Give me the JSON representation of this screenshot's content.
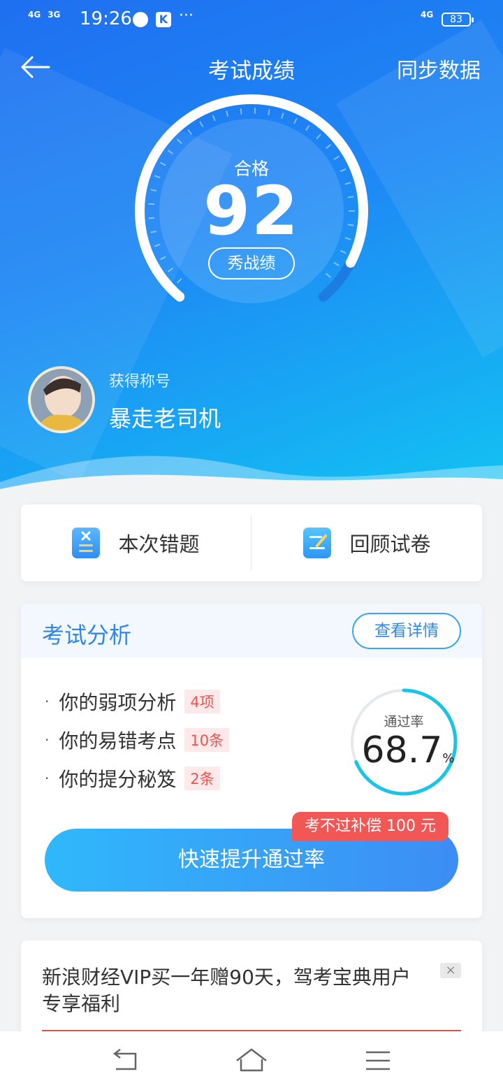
{
  "status_bar": {
    "network_1": "4G",
    "network_2": "3G",
    "time": "19:26",
    "more": "···",
    "signal_label": "4G",
    "battery": "83"
  },
  "header": {
    "title": "考试成绩",
    "sync_label": "同步数据"
  },
  "score": {
    "status_label": "合格",
    "value": "92",
    "share_label": "秀战绩",
    "progress": 0.92
  },
  "profile": {
    "caption": "获得称号",
    "title": "暴走老司机"
  },
  "actions": {
    "wrong_questions": "本次错题",
    "review_paper": "回顾试卷"
  },
  "analysis": {
    "title": "考试分析",
    "detail_button": "查看详情",
    "items": [
      {
        "text": "你的弱项分析",
        "tag": "4项"
      },
      {
        "text": "你的易错考点",
        "tag": "10条"
      },
      {
        "text": "你的提分秘笈",
        "tag": "2条"
      }
    ],
    "pass_rate_label": "通过率",
    "pass_rate_value": "68.7",
    "pass_rate_unit": "%",
    "boost_button": "快速提升通过率",
    "compensation_badge": "考不过补偿 100 元"
  },
  "promo": {
    "text": "新浪财经VIP买一年赠90天，驾考宝典用户专享福利",
    "close": "×"
  },
  "colors": {
    "hero_start": "#1f6ff0",
    "hero_end": "#12c3f2",
    "accent": "#2f88e8",
    "tag_red": "#f0514f",
    "ring_cyan": "#18c5e6"
  }
}
